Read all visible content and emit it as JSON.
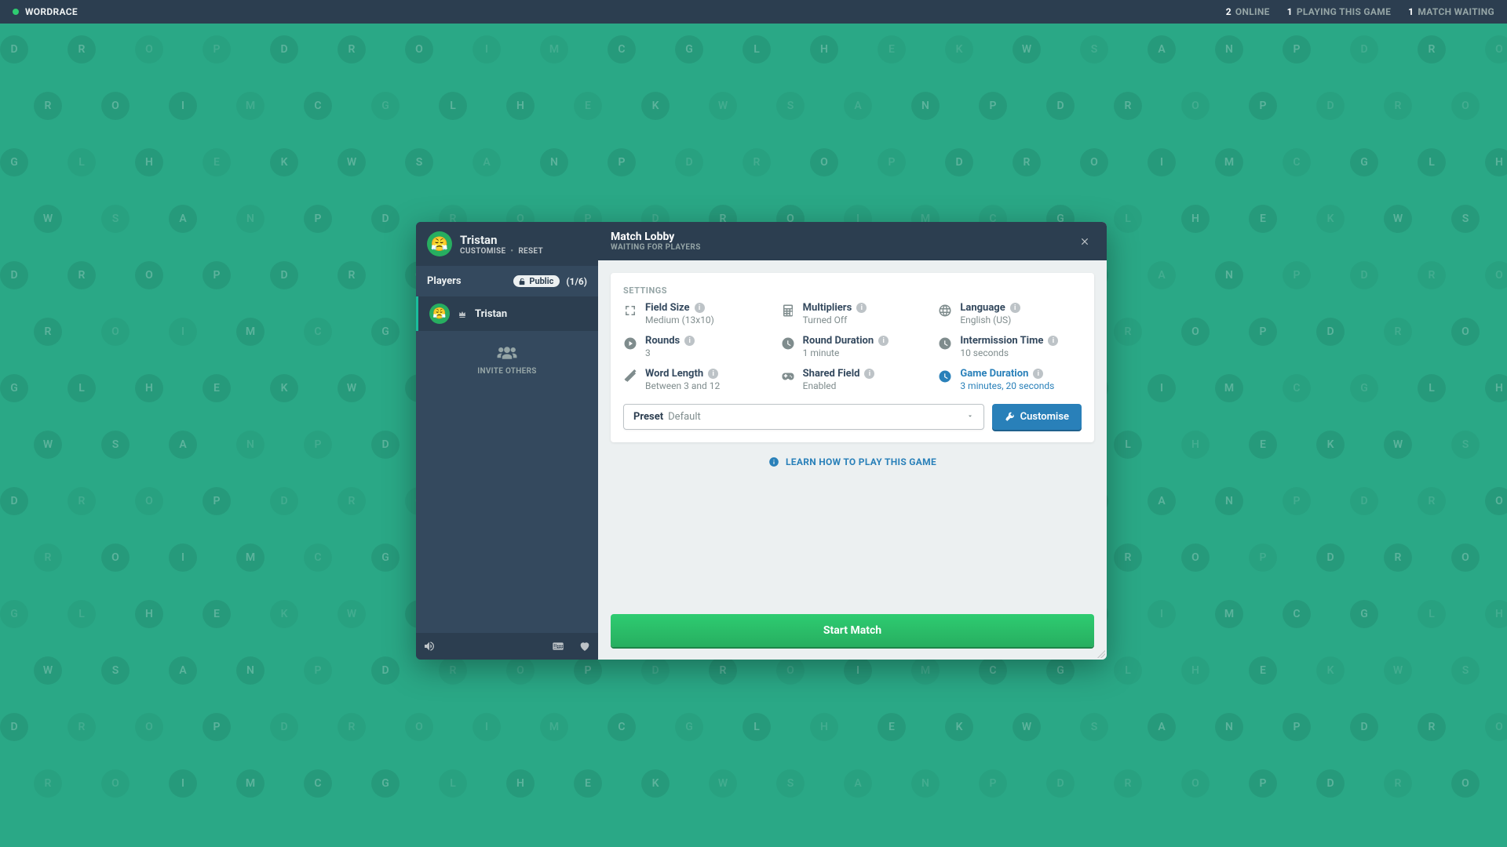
{
  "topbar": {
    "brand": "WORDRACE",
    "stats": [
      {
        "num": "2",
        "label": "ONLINE"
      },
      {
        "num": "1",
        "label": "PLAYING THIS GAME"
      },
      {
        "num": "1",
        "label": "MATCH WAITING"
      }
    ]
  },
  "sidebar": {
    "player_name": "Tristan",
    "customise_label": "CUSTOMISE",
    "reset_label": "RESET",
    "players_heading": "Players",
    "public_label": "Public",
    "player_count": "(1/6)",
    "host_name": "Tristan",
    "invite_label": "INVITE OTHERS"
  },
  "lobby": {
    "title": "Match Lobby",
    "subtitle": "WAITING FOR PLAYERS",
    "settings_heading": "SETTINGS",
    "settings": [
      {
        "key": "field_size",
        "label": "Field Size",
        "value": "Medium (13x10)",
        "icon": "expand"
      },
      {
        "key": "multipliers",
        "label": "Multipliers",
        "value": "Turned Off",
        "icon": "calculator"
      },
      {
        "key": "language",
        "label": "Language",
        "value": "English (US)",
        "icon": "globe"
      },
      {
        "key": "rounds",
        "label": "Rounds",
        "value": "3",
        "icon": "play"
      },
      {
        "key": "round_duration",
        "label": "Round Duration",
        "value": "1 minute",
        "icon": "clock"
      },
      {
        "key": "intermission",
        "label": "Intermission Time",
        "value": "10 seconds",
        "icon": "clock"
      },
      {
        "key": "word_length",
        "label": "Word Length",
        "value": "Between 3 and 12",
        "icon": "ruler"
      },
      {
        "key": "shared_field",
        "label": "Shared Field",
        "value": "Enabled",
        "icon": "gamepad"
      },
      {
        "key": "game_duration",
        "label": "Game Duration",
        "value": "3 minutes, 20 seconds",
        "icon": "clock",
        "highlight": true
      }
    ],
    "preset_label": "Preset",
    "preset_value": "Default",
    "customise_btn": "Customise",
    "learn_link": "LEARN HOW TO PLAY THIS GAME",
    "start_btn": "Start Match"
  },
  "bg_letters": [
    "P",
    "D",
    "R",
    "O",
    "P",
    "D",
    "R",
    "O",
    "I",
    "M",
    "C",
    "G",
    "L",
    "H",
    "E",
    "K",
    "W",
    "S",
    "A",
    "N"
  ]
}
